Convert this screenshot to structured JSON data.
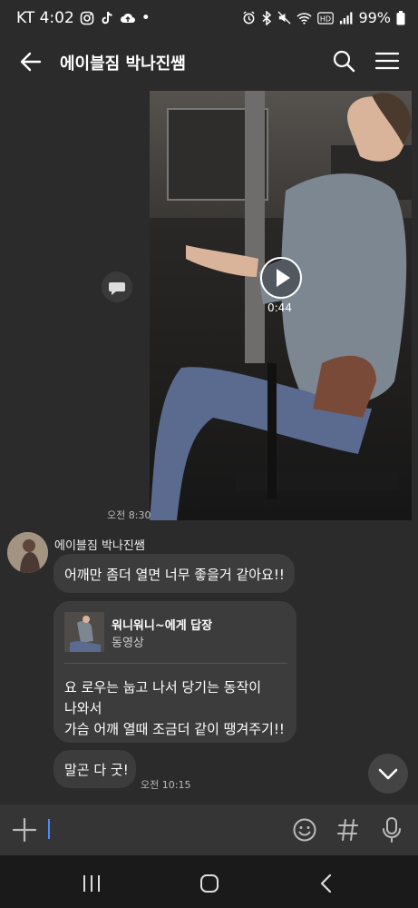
{
  "status": {
    "carrier_time": "KT 4:02",
    "dot": "•",
    "battery": "99%"
  },
  "header": {
    "title": "에이블짐 박나진쌤"
  },
  "video": {
    "duration": "0:44",
    "time": "오전 8:30"
  },
  "chat": {
    "sender": "에이블짐 박나진쌤",
    "message1": "어깨만 좀더 열면 너무 좋을거 같아요!!",
    "reply": {
      "to": "워니워니~에게 답장",
      "type": "동영상",
      "line1": "요 로우는 눕고 나서 당기는 동작이",
      "line2": "나와서",
      "line3": "가슴 어깨 열때 조금더 같이 땡겨주기!!"
    },
    "message3": "말곤 다 굿!",
    "time": "오전 10:15"
  }
}
